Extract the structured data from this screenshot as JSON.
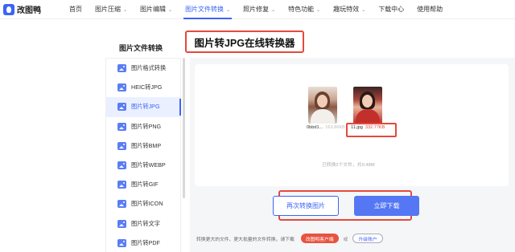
{
  "brand": {
    "name": "改图鸭"
  },
  "nav": {
    "items": [
      {
        "label": "首页",
        "has_menu": false
      },
      {
        "label": "图片压缩",
        "has_menu": true
      },
      {
        "label": "图片编辑",
        "has_menu": true
      },
      {
        "label": "图片文件转换",
        "has_menu": true,
        "active": true
      },
      {
        "label": "照片修复",
        "has_menu": true
      },
      {
        "label": "特色功能",
        "has_menu": true
      },
      {
        "label": "趣玩特效",
        "has_menu": true
      },
      {
        "label": "下载中心",
        "has_menu": false
      },
      {
        "label": "使用帮助",
        "has_menu": false
      }
    ],
    "chevron": "⌄"
  },
  "sidebar": {
    "heading": "图片文件转换",
    "items": [
      {
        "label": "图片格式转换",
        "icon": "image-icon"
      },
      {
        "label": "HEIC转JPG",
        "icon": "image-icon"
      },
      {
        "label": "图片转JPG",
        "icon": "image-icon",
        "active": true
      },
      {
        "label": "图片转PNG",
        "icon": "image-icon"
      },
      {
        "label": "图片转BMP",
        "icon": "image-icon"
      },
      {
        "label": "图片转WEBP",
        "icon": "image-icon"
      },
      {
        "label": "图片转GIF",
        "icon": "image-icon"
      },
      {
        "label": "图片转ICON",
        "icon": "image-icon"
      },
      {
        "label": "图片转文字",
        "icon": "image-icon"
      },
      {
        "label": "图片转PDF",
        "icon": "image-icon"
      }
    ]
  },
  "main": {
    "title": "图片转JPG在线转换器",
    "files": [
      {
        "name": "0bbd1...",
        "size": "163.86KB"
      },
      {
        "name": "11.jpg",
        "size": "332.77KB"
      }
    ],
    "status": "已转换2个文件，共0.48M",
    "convert_again_label": "再次转换图片",
    "download_label": "立即下载"
  },
  "footer": {
    "tip": "转换更大的文件、更大批量的文件转换，请下载",
    "member_label": "改图鸭客户端",
    "or": "或",
    "upgrade_label": "升级账户"
  },
  "colors": {
    "accent": "#3b64f6",
    "highlight_box": "#e34a3c"
  }
}
